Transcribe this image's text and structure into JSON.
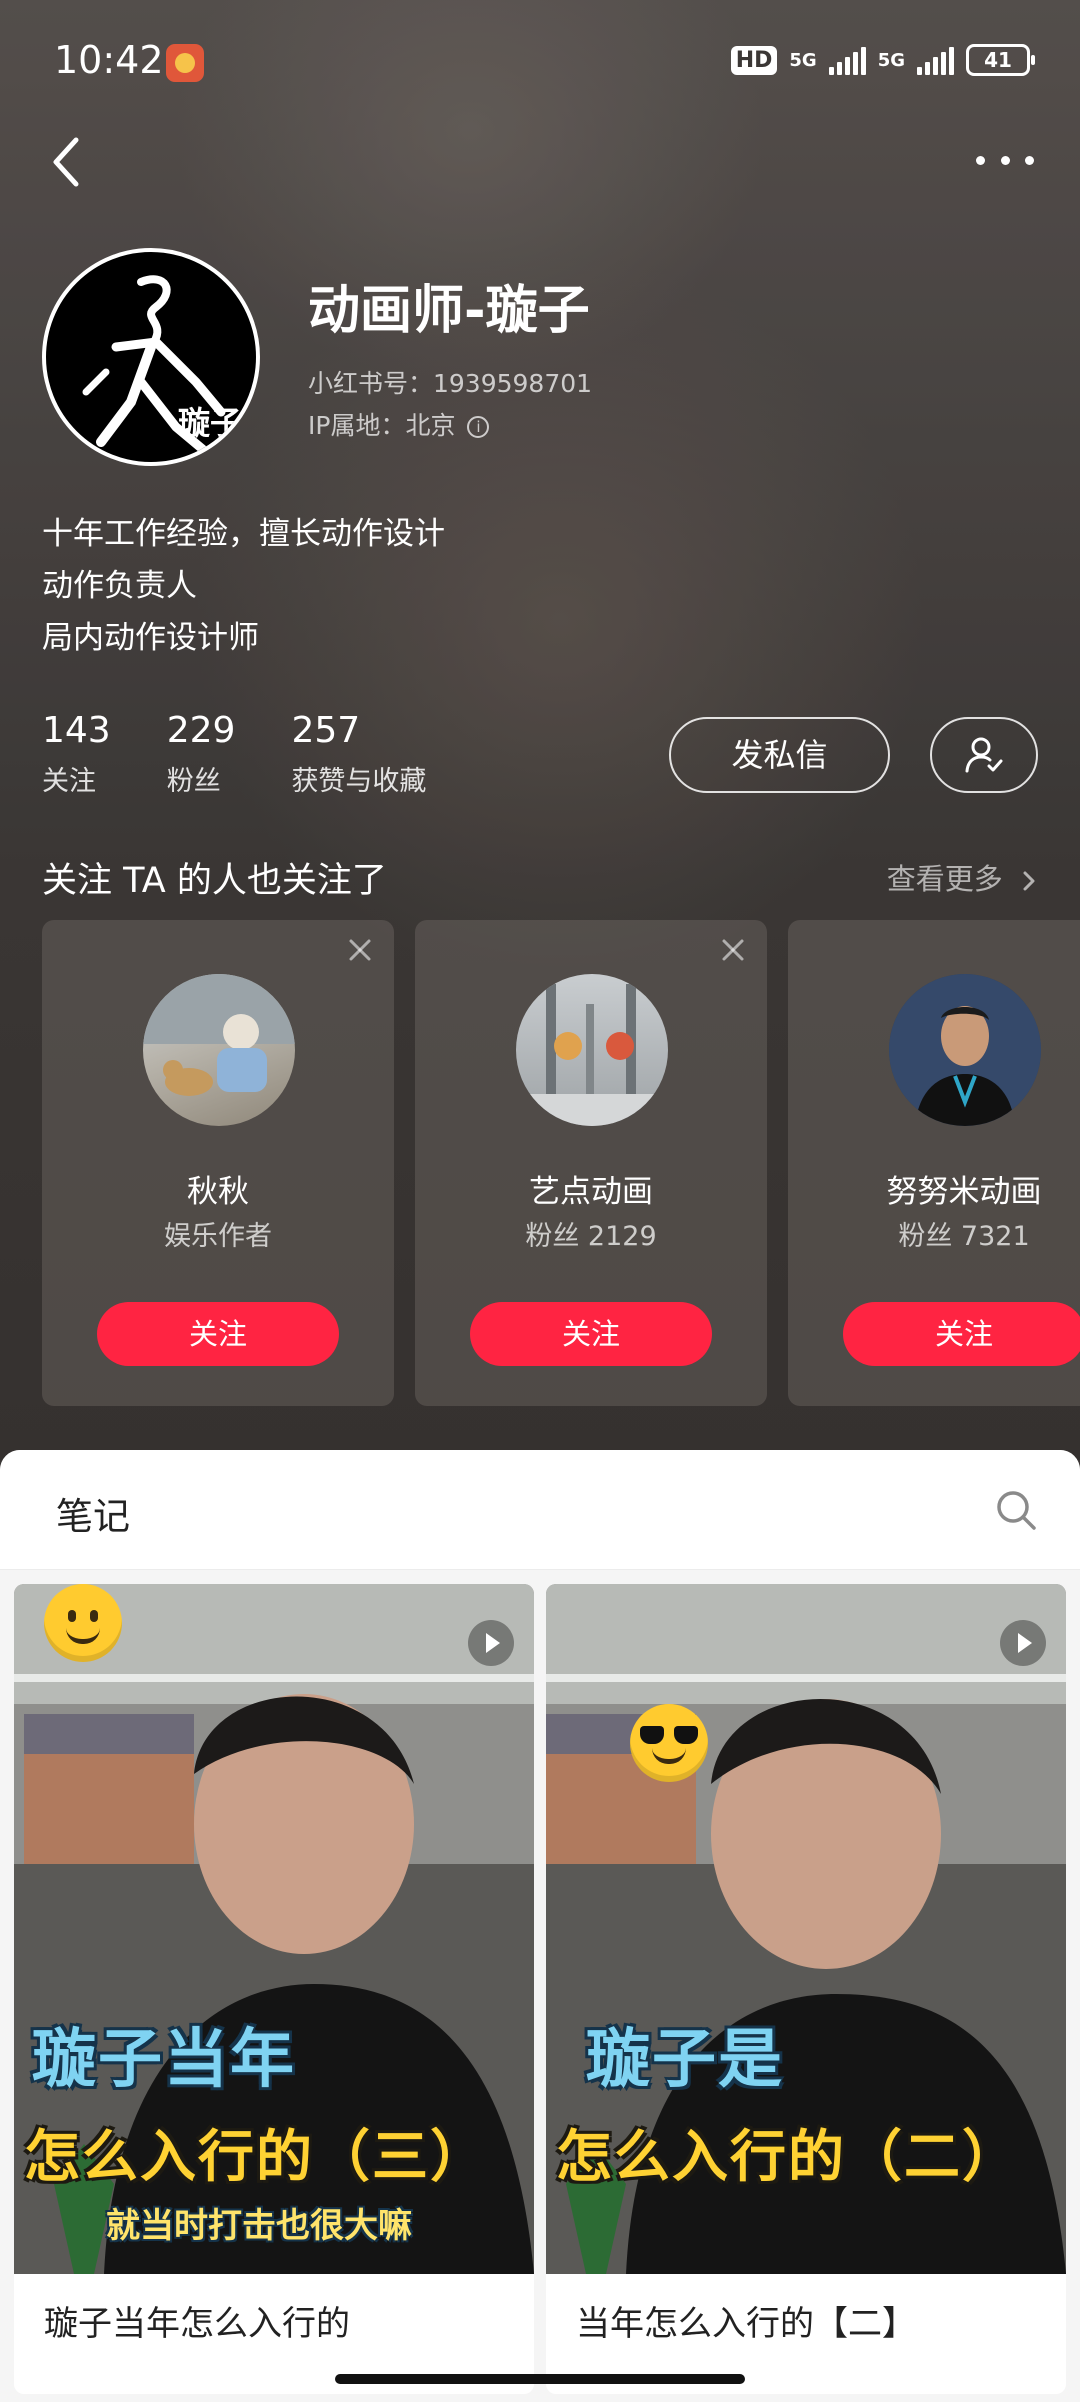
{
  "status_bar": {
    "time": "10:42",
    "hd": "HD",
    "net1": "5G",
    "net2": "5G",
    "battery": "41"
  },
  "profile": {
    "nickname": "动画师-璇子",
    "avatar_caption": "璇子",
    "account_id_label": "小红书号：1939598701",
    "ip_label": "IP属地：北京",
    "bio": [
      "十年工作经验，擅长动作设计",
      "动作负责人",
      "局内动作设计师"
    ],
    "stats": [
      {
        "value": "143",
        "label": "关注"
      },
      {
        "value": "229",
        "label": "粉丝"
      },
      {
        "value": "257",
        "label": "获赞与收藏"
      }
    ],
    "message_button": "发私信"
  },
  "recommend": {
    "title": "关注 TA 的人也关注了",
    "more": "查看更多",
    "items": [
      {
        "name": "秋秋",
        "sub": "娱乐作者",
        "follow": "关注"
      },
      {
        "name": "艺点动画",
        "sub": "粉丝 2129",
        "follow": "关注"
      },
      {
        "name": "努努米动画",
        "sub": "粉丝 7321",
        "follow": "关注"
      }
    ]
  },
  "notes": {
    "tab_label": "笔记",
    "cards": [
      {
        "title": "璇子当年怎么入行的",
        "cover_line1": "璇子当年",
        "cover_line2": "怎么入行的（三）",
        "cover_sub": "就当时打击也很大嘛"
      },
      {
        "title": "当年怎么入行的【二】",
        "cover_line1": "璇子是",
        "cover_line2": "怎么入行的（二）"
      }
    ]
  },
  "colors": {
    "accent": "#ff2442",
    "sheet_bg": "#f5f5f5"
  },
  "icons": {
    "back": "chevron-left-icon",
    "more": "more-dots-icon",
    "info": "info-icon",
    "follow_state": "user-check-icon",
    "close": "close-icon",
    "chevron": "chevron-right-icon",
    "search": "search-icon",
    "play": "play-icon"
  }
}
